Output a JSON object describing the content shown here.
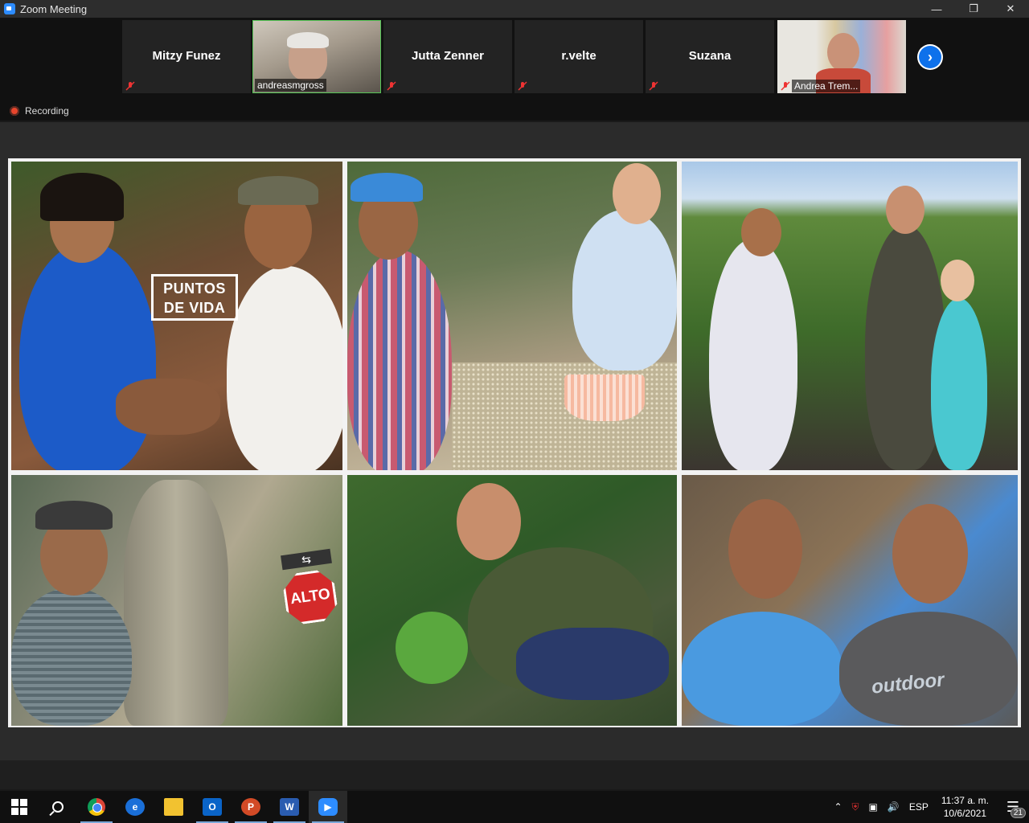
{
  "window": {
    "title": "Zoom Meeting",
    "minimize": "—",
    "restore": "❐",
    "close": "✕"
  },
  "participants": [
    {
      "name": "Mitzy Funez",
      "video": false,
      "muted": true
    },
    {
      "name": "andreasmgross",
      "video": true,
      "muted": false
    },
    {
      "name": "Jutta Zenner",
      "video": false,
      "muted": true
    },
    {
      "name": "r.velte",
      "video": false,
      "muted": true
    },
    {
      "name": "Suzana",
      "video": false,
      "muted": true
    },
    {
      "name": "Andrea Trem...",
      "video": true,
      "muted": true
    }
  ],
  "next_page": "›",
  "recording": {
    "label": "Recording"
  },
  "shared_content": {
    "sign_text": "PUNTOS DE VIDA",
    "stop_sign": "ALTO",
    "arrow_sign": "⇆",
    "shirt_text": "outdoor"
  },
  "taskbar": {
    "apps": [
      "start",
      "search",
      "chrome",
      "edge",
      "file-explorer",
      "outlook",
      "powerpoint",
      "word",
      "zoom"
    ],
    "language": "ESP",
    "time": "11:37 a. m.",
    "date": "10/6/2021",
    "notification_count": "21"
  }
}
